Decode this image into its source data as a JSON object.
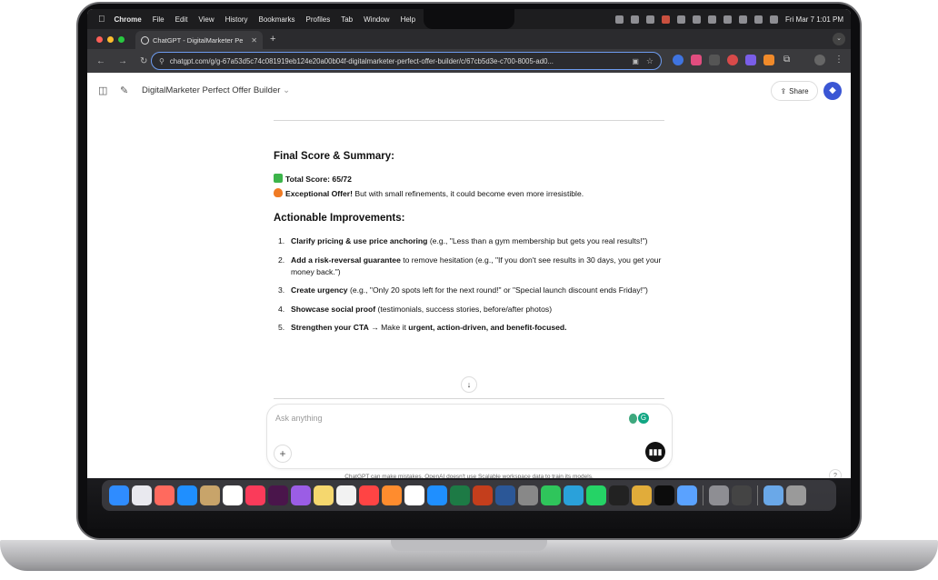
{
  "menubar": {
    "app_name": "Chrome",
    "menus": [
      "File",
      "Edit",
      "View",
      "History",
      "Bookmarks",
      "Profiles",
      "Tab",
      "Window",
      "Help"
    ],
    "datetime": "Fri Mar 7  1:01 PM"
  },
  "browser": {
    "tab_title": "ChatGPT - DigitalMarketer Pe",
    "new_tab": "+",
    "url": "chatgpt.com/g/g-67a53d5c74c081919eb124e20a00b04f-digitalmarketer-perfect-offer-builder/c/67cb5d3e-c700-8005-ad0..."
  },
  "gpt": {
    "title": "DigitalMarketer Perfect Offer Builder",
    "share_label": "Share"
  },
  "summary": {
    "heading": "Final Score & Summary:",
    "score_label": "Total Score: 65/72",
    "offer_bold": "Exceptional Offer!",
    "offer_rest": " But with small refinements, it could become even more irresistible."
  },
  "improvements": {
    "heading": "Actionable Improvements:",
    "items": [
      {
        "num": "1.",
        "bold": "Clarify pricing & use price anchoring",
        "rest": " (e.g., \"Less than a gym membership but gets you real results!\")",
        "bold2": "",
        "rest2": ""
      },
      {
        "num": "2.",
        "bold": "Add a risk-reversal guarantee",
        "rest": " to remove hesitation (e.g., \"If you don't see results in 30 days, you get your money back.\")",
        "bold2": "",
        "rest2": ""
      },
      {
        "num": "3.",
        "bold": "Create urgency",
        "rest": " (e.g., \"Only 20 spots left for the next round!\" or \"Special launch discount ends Friday!\")",
        "bold2": "",
        "rest2": ""
      },
      {
        "num": "4.",
        "bold": "Showcase social proof",
        "rest": " (testimonials, success stories, before/after photos)",
        "bold2": "",
        "rest2": ""
      },
      {
        "num": "5.",
        "bold": "Strengthen your CTA",
        "rest": " → Make it ",
        "bold2": "urgent, action-driven, and benefit-focused.",
        "rest2": ""
      }
    ]
  },
  "composer": {
    "placeholder": "Ask anything"
  },
  "disclaimer": "ChatGPT can make mistakes. OpenAI doesn't use Scalable workspace data to train its models.",
  "help_label": "?",
  "colors": {
    "accent_blue": "#3a56d4",
    "grammarly_green": "#11a683",
    "focus_ring": "#6e9cf0"
  },
  "dock_apps": [
    "finder-icon",
    "launchpad-icon",
    "apps-icon",
    "safari-icon",
    "notes-icon",
    "calendar-icon",
    "music-icon",
    "slack-icon",
    "podcasts-icon",
    "stickies-icon",
    "photos-icon",
    "news-icon",
    "books-icon",
    "chrome-icon",
    "app-store-icon",
    "excel-icon",
    "powerpoint-icon",
    "word-icon",
    "calculator-icon",
    "messages-icon",
    "telegram-icon",
    "whatsapp-icon",
    "chatgpt-desktop-icon",
    "keynote-icon",
    "openai-icon",
    "preview-icon",
    "settings-icon",
    "scanner-icon",
    "folder-icon",
    "trash-icon"
  ]
}
